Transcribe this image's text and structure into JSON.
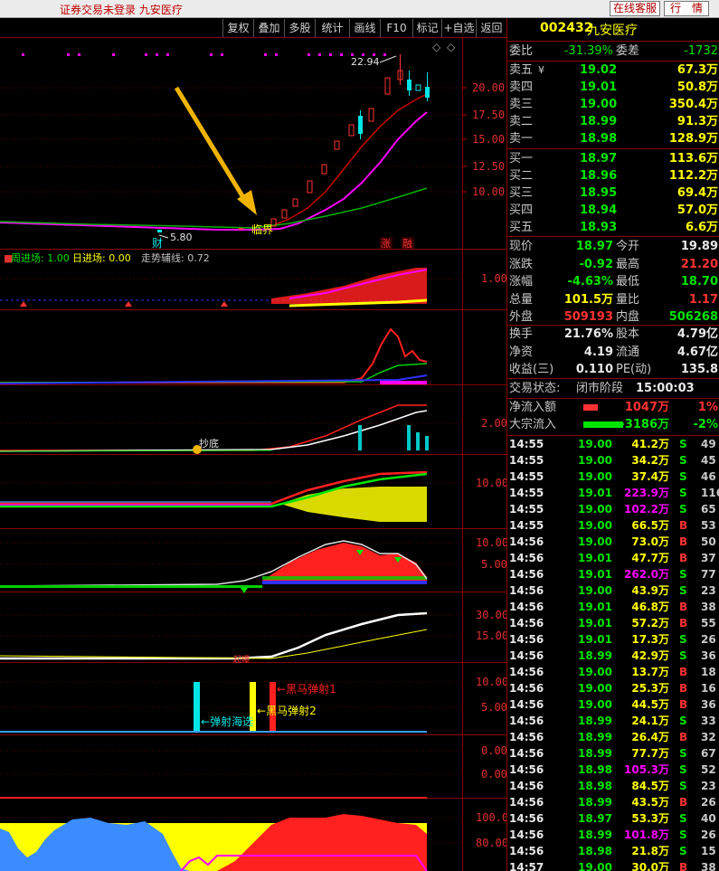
{
  "titlebar": {
    "title": "证券交易未登录  九安医疗",
    "btn_service": "在线客服",
    "btn_quote": "行　情"
  },
  "toolbar": {
    "items": [
      "复权",
      "叠加",
      "多股",
      "统计",
      "画线",
      "F10",
      "标记",
      "+自选",
      "返回"
    ]
  },
  "chart": {
    "price_axis": [
      "20.00",
      "17.50",
      "15.00",
      "12.50",
      "10.00"
    ],
    "high_label": "22.94",
    "low_label": "5.80",
    "marker_cai": "财",
    "marker_zhang": "涨",
    "marker_rong": "融",
    "linjie": "临界",
    "ind1_legend": {
      "a": "周进场: 1.00",
      "b": "日进场: 0.00",
      "c": "走势辅线: 0.72"
    },
    "ind1_axis": [
      "1.00"
    ],
    "ind3_axis": [
      "2.00"
    ],
    "chaodi": "抄底",
    "ind4_axis": [
      "10.00"
    ],
    "ind5_axis": [
      "10.00",
      "5.00"
    ],
    "ind6_axis": [
      "30.00",
      "15.00"
    ],
    "ind6_mark": "起爆",
    "ind7_axis": [
      "10.00",
      "5.00"
    ],
    "ind7_labels": [
      "弹射海选",
      "黑马弹射2",
      "黑马弹射1"
    ],
    "ind8_axis": [
      "0.00",
      "0.00"
    ],
    "ind9_axis": [
      "100.0",
      "80.00"
    ]
  },
  "panel": {
    "code": "002432",
    "name": "九安医疗",
    "weibi_label": "委比",
    "weibi": "-31.39%",
    "weicha_label": "委差",
    "weicha": "-1732",
    "sells": [
      {
        "label": "卖五",
        "price": "19.02",
        "vol": "67.3万",
        "mark": "¥"
      },
      {
        "label": "卖四",
        "price": "19.01",
        "vol": "50.8万",
        "mark": ""
      },
      {
        "label": "卖三",
        "price": "19.00",
        "vol": "350.4万",
        "mark": ""
      },
      {
        "label": "卖二",
        "price": "18.99",
        "vol": "91.3万",
        "mark": ""
      },
      {
        "label": "卖一",
        "price": "18.98",
        "vol": "128.9万",
        "mark": ""
      }
    ],
    "buys": [
      {
        "label": "买一",
        "price": "18.97",
        "vol": "113.6万"
      },
      {
        "label": "买二",
        "price": "18.96",
        "vol": "112.2万"
      },
      {
        "label": "买三",
        "price": "18.95",
        "vol": "69.4万"
      },
      {
        "label": "买四",
        "price": "18.94",
        "vol": "57.0万"
      },
      {
        "label": "买五",
        "price": "18.93",
        "vol": "6.6万"
      }
    ],
    "quote": [
      {
        "l1": "现价",
        "v1": "18.97",
        "c1": "grn",
        "l2": "今开",
        "v2": "19.89",
        "c2": "wht"
      },
      {
        "l1": "涨跌",
        "v1": "-0.92",
        "c1": "grn",
        "l2": "最高",
        "v2": "21.20",
        "c2": "red"
      },
      {
        "l1": "涨幅",
        "v1": "-4.63%",
        "c1": "grn",
        "l2": "最低",
        "v2": "18.70",
        "c2": "grn"
      },
      {
        "l1": "总量",
        "v1": "101.5万",
        "c1": "yel",
        "l2": "量比",
        "v2": "1.17",
        "c2": "red"
      },
      {
        "l1": "外盘",
        "v1": "509193",
        "c1": "red",
        "l2": "内盘",
        "v2": "506268",
        "c2": "grn"
      }
    ],
    "fin": [
      {
        "l1": "换手",
        "v1": "21.76%",
        "l2": "股本",
        "v2": "4.79亿"
      },
      {
        "l1": "净资",
        "v1": "4.19",
        "l2": "流通",
        "v2": "4.67亿"
      },
      {
        "l1": "收益(三)",
        "v1": "0.110",
        "l2": "PE(动)",
        "v2": "135.8"
      }
    ],
    "status_label": "交易状态:",
    "status": "闭市阶段",
    "status_time": "15:00:03",
    "flow": [
      {
        "label": "净流入额",
        "val": "1047万",
        "pct": "1%",
        "color": "#ff3232"
      },
      {
        "label": "大宗流入",
        "val": "-3186万",
        "pct": "-2%",
        "color": "#00e600"
      }
    ],
    "ticks": [
      [
        "14:55",
        "19.00",
        "41.2万",
        "S",
        "49",
        "w"
      ],
      [
        "14:55",
        "19.00",
        "34.2万",
        "S",
        "45",
        "w"
      ],
      [
        "14:55",
        "19.00",
        "37.4万",
        "S",
        "46",
        "w"
      ],
      [
        "14:55",
        "19.01",
        "223.9万",
        "S",
        "116",
        "m"
      ],
      [
        "14:55",
        "19.00",
        "102.2万",
        "S",
        "65",
        "m"
      ],
      [
        "14:55",
        "19.00",
        "66.5万",
        "B",
        "53",
        "w"
      ],
      [
        "14:56",
        "19.00",
        "73.0万",
        "B",
        "50",
        "w"
      ],
      [
        "14:56",
        "19.01",
        "47.7万",
        "B",
        "37",
        "w"
      ],
      [
        "14:56",
        "19.01",
        "262.0万",
        "S",
        "77",
        "m"
      ],
      [
        "14:56",
        "19.00",
        "43.9万",
        "S",
        "23",
        "w"
      ],
      [
        "14:56",
        "19.01",
        "46.8万",
        "B",
        "38",
        "w"
      ],
      [
        "14:56",
        "19.01",
        "57.2万",
        "B",
        "55",
        "w"
      ],
      [
        "14:56",
        "19.01",
        "17.3万",
        "S",
        "26",
        "w"
      ],
      [
        "14:56",
        "18.99",
        "42.9万",
        "S",
        "36",
        "w"
      ],
      [
        "14:56",
        "19.00",
        "13.7万",
        "B",
        "18",
        "w"
      ],
      [
        "14:56",
        "19.00",
        "25.3万",
        "B",
        "16",
        "w"
      ],
      [
        "14:56",
        "19.00",
        "44.5万",
        "B",
        "36",
        "w"
      ],
      [
        "14:56",
        "18.99",
        "24.1万",
        "S",
        "33",
        "w"
      ],
      [
        "14:56",
        "18.99",
        "26.4万",
        "B",
        "32",
        "w"
      ],
      [
        "14:56",
        "18.99",
        "77.7万",
        "S",
        "67",
        "w"
      ],
      [
        "14:56",
        "18.98",
        "105.3万",
        "S",
        "52",
        "m"
      ],
      [
        "14:56",
        "18.98",
        "84.5万",
        "S",
        "23",
        "w"
      ],
      [
        "14:56",
        "18.99",
        "43.5万",
        "B",
        "26",
        "w"
      ],
      [
        "14:56",
        "18.97",
        "53.3万",
        "S",
        "40",
        "w"
      ],
      [
        "14:56",
        "18.99",
        "101.8万",
        "S",
        "26",
        "m"
      ],
      [
        "14:56",
        "18.98",
        "21.8万",
        "S",
        "15",
        "w"
      ],
      [
        "14:57",
        "19.00",
        "30.0万",
        "B",
        "38",
        "w"
      ]
    ]
  }
}
